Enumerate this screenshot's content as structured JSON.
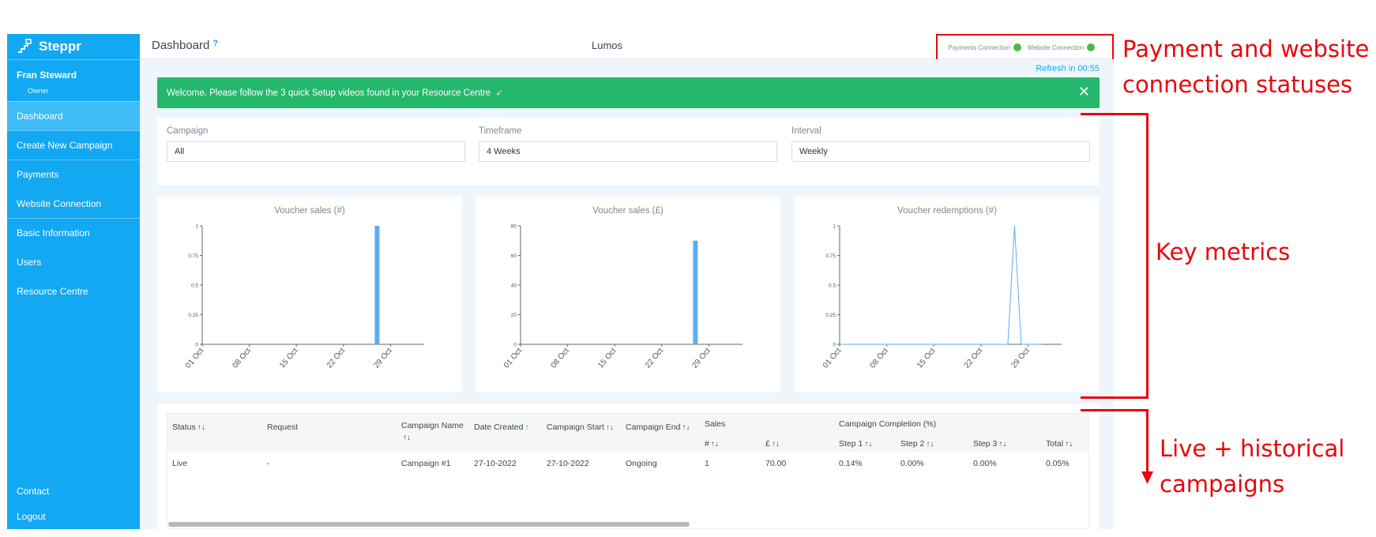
{
  "app": {
    "brand": "Steppr",
    "title": "Dashboard",
    "help": "?",
    "org_name": "Lumos"
  },
  "user": {
    "name": "Fran Steward",
    "role": "Owner"
  },
  "sidebar": {
    "items": [
      {
        "label": "Dashboard",
        "active": true
      },
      {
        "label": "Create New Campaign"
      },
      {
        "label": "Payments"
      },
      {
        "label": "Website Connection"
      },
      {
        "label": "Basic Information"
      },
      {
        "label": "Users"
      },
      {
        "label": "Resource Centre"
      }
    ],
    "bottom": [
      {
        "label": "Contact"
      },
      {
        "label": "Logout"
      }
    ]
  },
  "connection": {
    "payments_label": "Payments Connection",
    "website_label": "Website Connection",
    "payments_status_color": "#4cb944",
    "website_status_color": "#4cb944"
  },
  "refresh": "Refresh in 00:55",
  "alert": {
    "text": "Welcome. Please follow the 3 quick Setup videos found in your Resource Centre",
    "close": "✕"
  },
  "filters": {
    "campaign": {
      "label": "Campaign",
      "value": "All"
    },
    "timeframe": {
      "label": "Timeframe",
      "value": "4 Weeks"
    },
    "interval": {
      "label": "Interval",
      "value": "Weekly"
    }
  },
  "chart_data": [
    {
      "type": "bar",
      "title": "Voucher sales (#)",
      "x_ticks": [
        "01 Oct",
        "08 Oct",
        "15 Oct",
        "22 Oct",
        "29 Oct"
      ],
      "ylim": [
        0,
        1
      ],
      "y_ticks": [
        "0",
        "0.25",
        "0.5",
        "0.75",
        "1"
      ],
      "points": [
        {
          "x": "27 Oct",
          "value": 1
        }
      ],
      "color": "#5aaef2"
    },
    {
      "type": "bar",
      "title": "Voucher sales (£)",
      "x_ticks": [
        "01 Oct",
        "08 Oct",
        "15 Oct",
        "22 Oct",
        "29 Oct"
      ],
      "ylim": [
        0,
        80
      ],
      "y_ticks": [
        "0",
        "20",
        "40",
        "60",
        "80"
      ],
      "points": [
        {
          "x": "27 Oct",
          "value": 70
        }
      ],
      "color": "#5aaef2"
    },
    {
      "type": "line",
      "title": "Voucher redemptions (#)",
      "x_ticks": [
        "01 Oct",
        "08 Oct",
        "15 Oct",
        "22 Oct",
        "29 Oct"
      ],
      "ylim": [
        0,
        1
      ],
      "y_ticks": [
        "0",
        "0.25",
        "0.5",
        "0.75",
        "1"
      ],
      "points": [
        {
          "x": "01 Oct",
          "value": 0
        },
        {
          "x": "26 Oct",
          "value": 0
        },
        {
          "x": "27 Oct",
          "value": 1
        },
        {
          "x": "28 Oct",
          "value": 0
        },
        {
          "x": "31 Oct",
          "value": 0
        }
      ],
      "color": "#5aaef2"
    }
  ],
  "table": {
    "headers": {
      "status": "Status",
      "request": "Request",
      "campaign_name": "Campaign Name",
      "date_created": "Date Created",
      "campaign_start": "Campaign Start",
      "campaign_end": "Campaign End",
      "sales": "Sales",
      "sales_count": "#",
      "sales_gbp": "£",
      "completion": "Campaign Completion (%)",
      "step1": "Step 1",
      "step2": "Step 2",
      "step3": "Step 3",
      "total": "Total"
    },
    "rows": [
      {
        "status": "Live",
        "request": "-",
        "campaign_name": "Campaign #1",
        "date_created": "27-10-2022",
        "campaign_start": "27-10-2022",
        "campaign_end": "Ongoing",
        "sales_count": "1",
        "sales_gbp": "70.00",
        "step1": "0.14%",
        "step2": "0.00%",
        "step3": "0.00%",
        "total": "0.05%"
      }
    ]
  },
  "annotations": {
    "connections": "Payment and website connection statuses",
    "connections_line1": "Payment and website",
    "connections_line2": "connection statuses",
    "metrics": "Key metrics",
    "campaigns_line1": "Live + historical",
    "campaigns_line2": "campaigns"
  }
}
